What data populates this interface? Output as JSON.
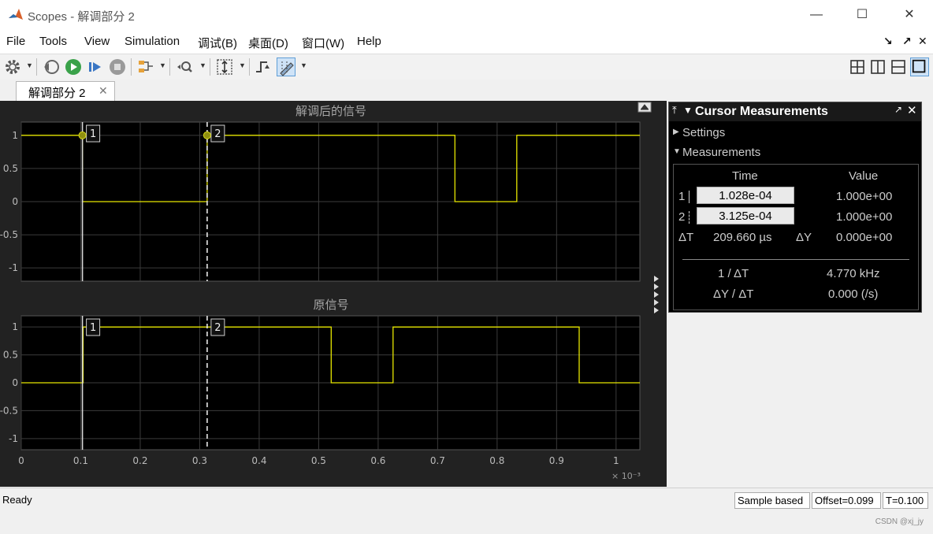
{
  "window": {
    "title": "Scopes - 解调部分 2",
    "minimize": "—",
    "maximize": "☐",
    "close": "✕"
  },
  "menu": {
    "items": [
      "File",
      "Tools",
      "View",
      "Simulation",
      "调试(B)",
      "桌面(D)",
      "窗口(W)",
      "Help"
    ],
    "undock": "↘",
    "popout": "↗",
    "close": "✕"
  },
  "toolbar": {
    "icons": [
      "gear-icon",
      "step-back-icon",
      "run-icon",
      "step-forward-icon",
      "stop-icon",
      "signal-highlight-icon",
      "zoom-icon",
      "scale-axes-icon",
      "triggers-icon",
      "cursor-measurements-icon"
    ],
    "layouts": [
      "layout-2x2-icon",
      "layout-columns-icon",
      "layout-rows-icon",
      "layout-single-icon"
    ]
  },
  "tab": {
    "label": "解调部分 2",
    "close": "✕"
  },
  "plots": [
    {
      "title": "解调后的信号",
      "yticks": [
        "1",
        "0.5",
        "0",
        "-0.5",
        "-1"
      ],
      "ylim": [
        -1.2,
        1.2
      ],
      "color": "#e6e600",
      "cursor_labels": [
        "1",
        "2"
      ]
    },
    {
      "title": "原信号",
      "yticks": [
        "1",
        "0.5",
        "0",
        "-0.5",
        "-1"
      ],
      "ylim": [
        -1.2,
        1.2
      ],
      "color": "#e6e600",
      "cursor_labels": [
        "1",
        "2"
      ]
    }
  ],
  "xaxis": {
    "ticks": [
      "0",
      "0.1",
      "0.2",
      "0.3",
      "0.4",
      "0.5",
      "0.6",
      "0.7",
      "0.8",
      "0.9",
      "1"
    ],
    "multiplier": "× 10⁻³",
    "xlim": [
      0,
      1.04
    ]
  },
  "chart_data": [
    {
      "type": "line",
      "title": "解调后的信号",
      "step": true,
      "series": [
        {
          "x": [
            0,
            0.103,
            0.103,
            0.3125,
            0.3125,
            0.729,
            0.729,
            0.833,
            0.833,
            1.04
          ],
          "y": [
            1,
            1,
            0,
            0,
            1,
            1,
            0,
            0,
            1,
            1
          ]
        }
      ],
      "ylim": [
        -1.2,
        1.2
      ],
      "xlim": [
        0,
        1.04
      ],
      "x_multiplier": "1e-3",
      "grid": true
    },
    {
      "type": "line",
      "title": "原信号",
      "step": true,
      "series": [
        {
          "x": [
            0,
            0.104,
            0.104,
            0.521,
            0.521,
            0.625,
            0.625,
            0.938,
            0.938,
            1.04
          ],
          "y": [
            0,
            0,
            1,
            1,
            0,
            0,
            1,
            1,
            0,
            0
          ]
        }
      ],
      "ylim": [
        -1.2,
        1.2
      ],
      "xlim": [
        0,
        1.04
      ],
      "x_multiplier": "1e-3",
      "grid": true
    }
  ],
  "cursors": {
    "c1": 0.1028,
    "c2": 0.3125
  },
  "cursor_panel": {
    "title": "Cursor Measurements",
    "settings": "Settings",
    "measurements": "Measurements",
    "col_time": "Time",
    "col_value": "Value",
    "row1_label": "1",
    "row1_time": "1.028e-04",
    "row1_value": "1.000e+00",
    "row2_label": "2",
    "row2_time": "3.125e-04",
    "row2_value": "1.000e+00",
    "dt_label": "ΔT",
    "dt_value": "209.660 µs",
    "dy_label": "ΔY",
    "dy_value": "0.000e+00",
    "inv_dt_label": "1 / ΔT",
    "inv_dt_value": "4.770 kHz",
    "dydt_label": "ΔY / ΔT",
    "dydt_value": "0.000 (/s)"
  },
  "status": {
    "text": "Ready",
    "mode": "Sample based",
    "offset": "Offset=0.099",
    "time": "T=0.100",
    "watermark": "CSDN @xj_jy"
  }
}
